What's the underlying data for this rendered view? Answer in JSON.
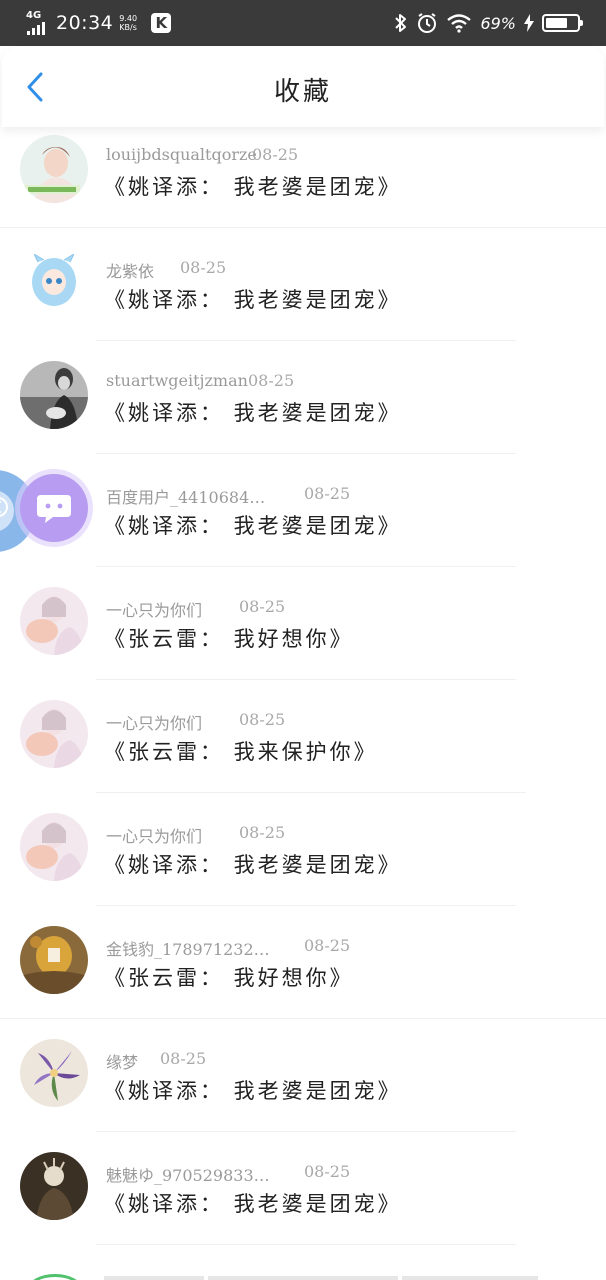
{
  "status_bar": {
    "network": "4G",
    "time": "20:34",
    "speed_value": "9.40",
    "speed_unit": "KB/s",
    "app_badge": "K",
    "battery_percent": "69%",
    "battery_level": 0.69,
    "icons": [
      "bluetooth-icon",
      "alarm-icon",
      "wifi-icon",
      "battery-icon",
      "charging-icon"
    ]
  },
  "header": {
    "title": "收藏",
    "back_icon": "chevron-left-icon",
    "accent_color": "#2f8fe8"
  },
  "items": [
    {
      "username": "louijbdsqualtqorze",
      "date": "08-25",
      "text": "《姚译添： 我老婆是团宠》"
    },
    {
      "username": "龙紫依",
      "date": "08-25",
      "text": "《姚译添： 我老婆是团宠》"
    },
    {
      "username": "stuartwgeitjzman",
      "date": "08-25",
      "text": "《姚译添： 我老婆是团宠》"
    },
    {
      "username": "百度用户_4410684…",
      "date": "08-25",
      "text": "《姚译添： 我老婆是团宠》"
    },
    {
      "username": "一心只为你们",
      "date": "08-25",
      "text": "《张云雷： 我好想你》"
    },
    {
      "username": "一心只为你们",
      "date": "08-25",
      "text": "《张云雷： 我来保护你》"
    },
    {
      "username": "一心只为你们",
      "date": "08-25",
      "text": "《姚译添： 我老婆是团宠》"
    },
    {
      "username": "金钱豹_178971232…",
      "date": "08-25",
      "text": "《张云雷： 我好想你》"
    },
    {
      "username": "缘梦",
      "date": "08-25",
      "text": "《姚译添： 我老婆是团宠》"
    },
    {
      "username": "魅魅ゆ_970529833…",
      "date": "08-25",
      "text": "《姚译添： 我老婆是团宠》"
    }
  ],
  "floating_widget": {
    "close_icon": "close-icon",
    "chat_icon": "chat-bubble-icon",
    "colors": {
      "purple": "#b79cf1",
      "blue": "#8ab7ea"
    }
  }
}
